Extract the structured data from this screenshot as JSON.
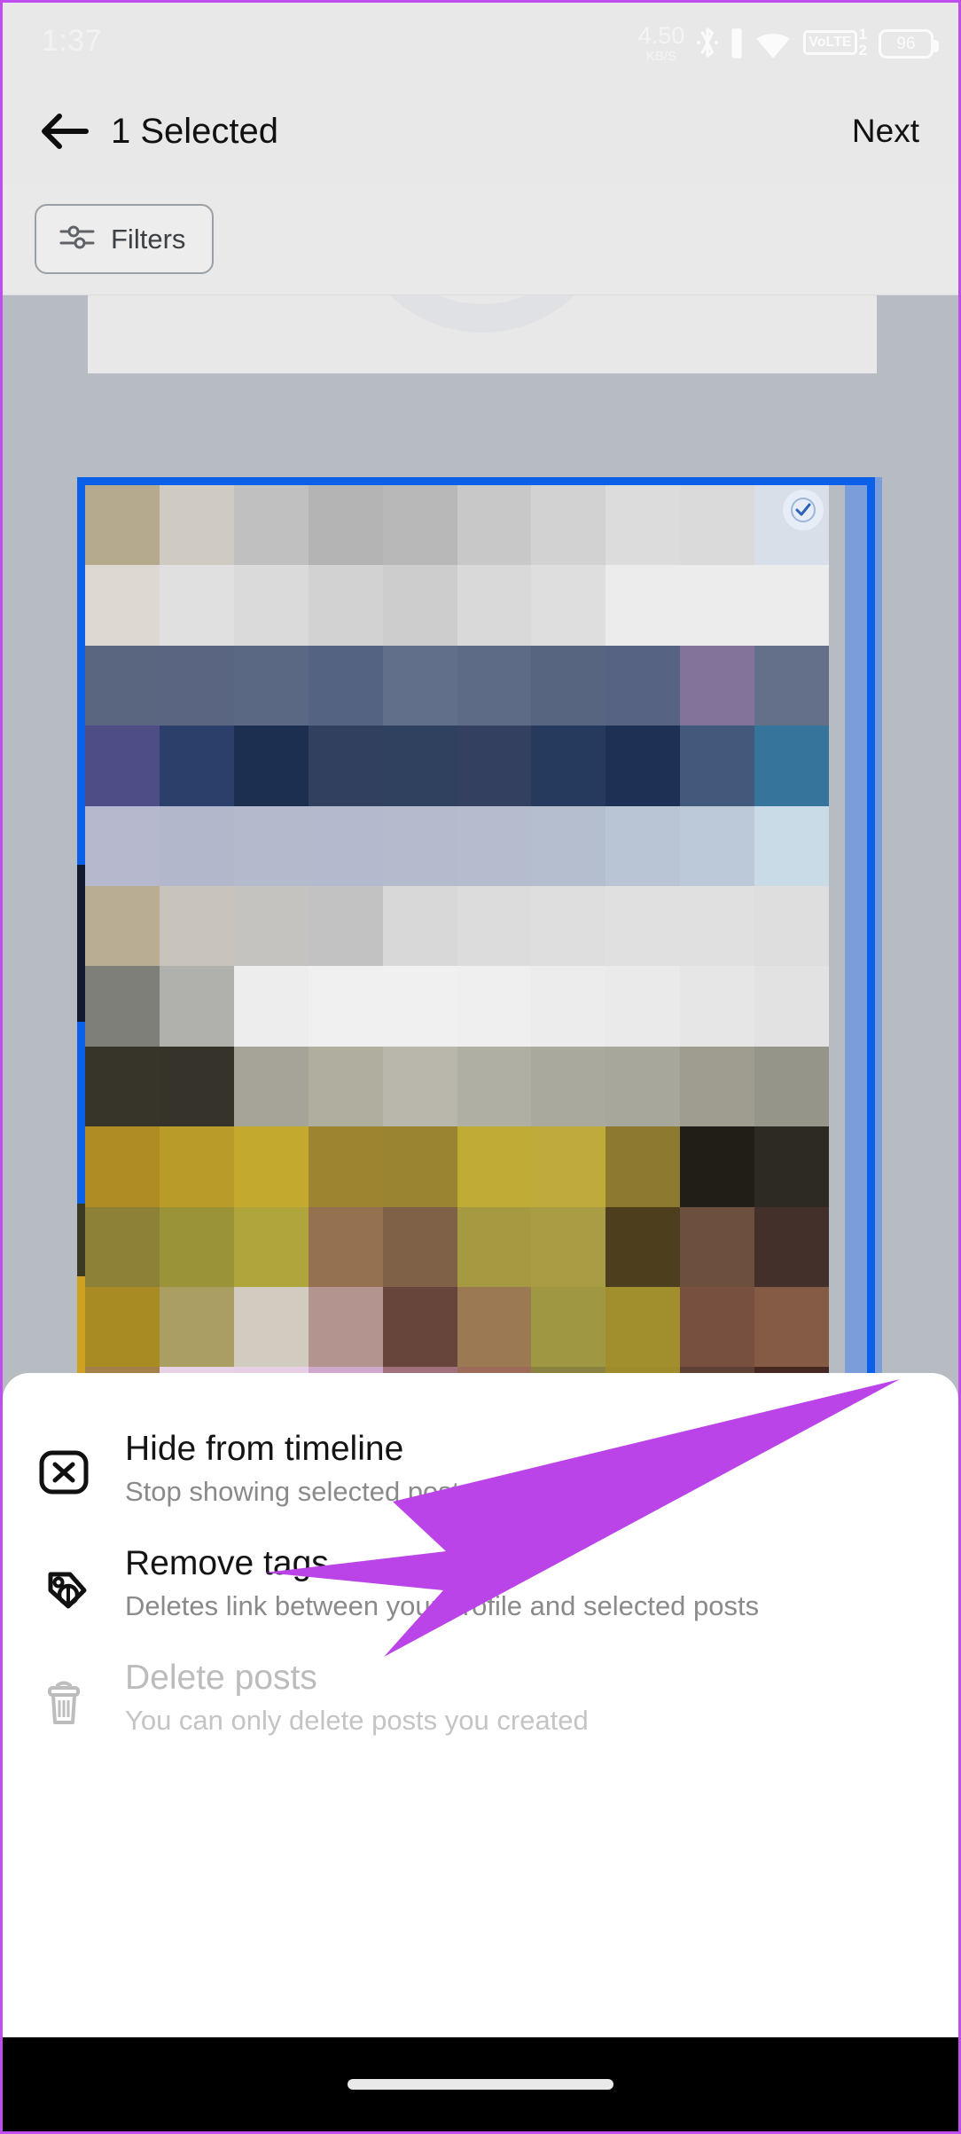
{
  "status_bar": {
    "time": "1:37",
    "net_speed_value": "4.50",
    "net_speed_unit": "KB/S",
    "bluetooth_icon": "bluetooth-icon",
    "signal_icon": "signal-bar-icon",
    "wifi_icon": "wifi-icon",
    "volte_label": "VoLTE",
    "volte_top_digit": "1",
    "volte_bottom_digit": "2",
    "battery_level": "96"
  },
  "app_bar": {
    "back_icon": "back-arrow-icon",
    "title": "1 Selected",
    "next_label": "Next"
  },
  "filter_bar": {
    "filters_label": "Filters",
    "filters_icon": "tune-sliders-icon"
  },
  "gallery": {
    "selected_badge_icon": "check-circle-icon",
    "selection_color": "#0b60ea",
    "selected_count": 1,
    "mosaic_rows": [
      [
        "#b5aa8e",
        "#cfcbc2",
        "#c0c0c0",
        "#b4b4b4",
        "#b8b8b8",
        "#c8c8c8",
        "#d2d2d2",
        "#dcdcdc",
        "#dadada",
        "#d8dfe9"
      ],
      [
        "#ded8d2",
        "#e0e0e0",
        "#dadada",
        "#d2d2d2",
        "#cdcdcd",
        "#d9d9d9",
        "#dedede",
        "#ececec",
        "#ececec",
        "#ececec"
      ],
      [
        "#5a6680",
        "#5a6681",
        "#5b6884",
        "#556382",
        "#626f8b",
        "#5e6b87",
        "#586581",
        "#576383",
        "#82739a",
        "#64708a"
      ],
      [
        "#4f4d86",
        "#2c3f6b",
        "#1d2f51",
        "#31405e",
        "#2f415f",
        "#33405f",
        "#253a5d",
        "#1e3154",
        "#43597b",
        "#36749c"
      ],
      [
        "#b6b8cd",
        "#b2b7cc",
        "#b3bacc",
        "#b3bacd",
        "#b4bbcd",
        "#b5bccd",
        "#b5becf",
        "#b9c4d4",
        "#bcc9d8",
        "#c8dbe6"
      ],
      [
        "#b9ad93",
        "#c8c4bb",
        "#c4c3c0",
        "#c2c2c2",
        "#d8d8d8",
        "#dcdcdc",
        "#dedede",
        "#e0e0e0",
        "#e0e0e0",
        "#dedede"
      ],
      [
        "#7e7f78",
        "#b0b0ac",
        "#ededed",
        "#f0f0f0",
        "#f0f0f0",
        "#efefef",
        "#ececec",
        "#eaeaea",
        "#e6e6e6",
        "#e2e2e2"
      ],
      [
        "#37352a",
        "#36342a",
        "#a6a499",
        "#b0ae9f",
        "#b9b7ab",
        "#b0afa4",
        "#aaa99d",
        "#a8a79b",
        "#9e9d90",
        "#96958a"
      ],
      [
        "#b08d22",
        "#b99b2a",
        "#c3a92e",
        "#9c8430",
        "#9a8431",
        "#c0ab36",
        "#bfab3b",
        "#8d7a2e",
        "#211e18",
        "#2d2a23"
      ],
      [
        "#8d8137",
        "#9b9338",
        "#b0a53c",
        "#94714f",
        "#7f6148",
        "#a59a42",
        "#a89d44",
        "#4d3e1d",
        "#6d4f3e",
        "#43302a"
      ],
      [
        "#a88b22",
        "#ab9e63",
        "#d2ccc0",
        "#b3948e",
        "#68453a",
        "#9b7a53",
        "#a09742",
        "#a08f2c",
        "#77503f",
        "#845b45"
      ],
      [
        "#a57f4a",
        "#e6d2e4",
        "#e7cfe6",
        "#cfa8cb",
        "#a1707d",
        "#9c6c58",
        "#8a8240",
        "#a08b2c",
        "#5f4034",
        "#462722"
      ],
      [
        "#9b8b65",
        "#d6b6d2",
        "#dfc4dc",
        "#6a5664",
        "#3b3045",
        "#1c1b2b",
        "#6d4e32",
        "#a5882c",
        "#8c3e30",
        "#6b1f22"
      ],
      [
        "#8e7a5e",
        "#c4a3b6",
        "#e0cbdd",
        "#4b3e4e",
        "#2a2736",
        "#14141f",
        "#5d432a",
        "#9a7e2a",
        "#7e2f27",
        "#6b1c1f"
      ],
      [
        "#9c6f4c",
        "#b08e98",
        "#e1c9de",
        "#e0c8dc",
        "#403347",
        "#131626",
        "#5c3e28",
        "#7e6a26",
        "#7c2227",
        "#701b1f"
      ]
    ]
  },
  "bottom_sheet": {
    "items": [
      {
        "icon": "x-square-icon",
        "title": "Hide from timeline",
        "subtitle": "Stop showing selected posts on your timeline",
        "disabled": false
      },
      {
        "icon": "tag-icon",
        "title": "Remove tags",
        "subtitle": "Deletes link between your profile and selected posts",
        "disabled": false
      },
      {
        "icon": "trash-icon",
        "title": "Delete posts",
        "subtitle": "You can only delete posts you created",
        "disabled": true
      }
    ]
  },
  "annotation": {
    "arrow_color": "#bb44e8",
    "points_to": "Remove tags"
  },
  "nav_bar": {
    "gesture_pill_icon": "home-gesture-pill"
  }
}
